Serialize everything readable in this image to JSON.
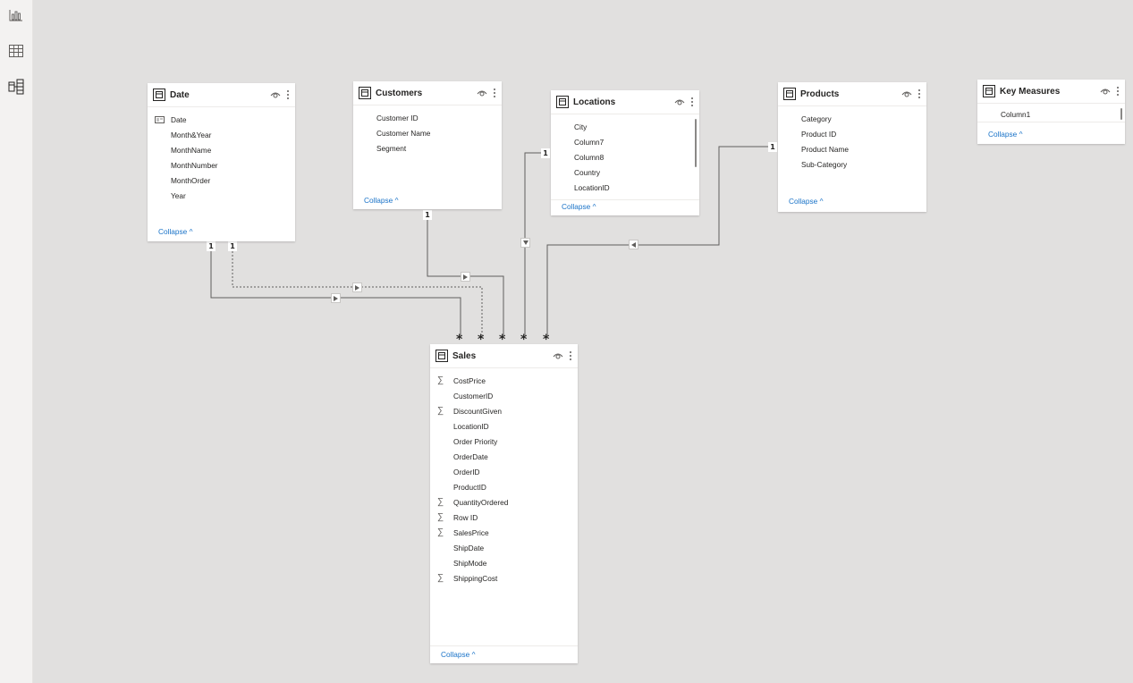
{
  "nav": {
    "report_icon": "bar-chart-icon",
    "data_icon": "table-grid-icon",
    "model_icon": "model-view-icon"
  },
  "colors": {
    "canvas": "#e1e0df",
    "accent_link": "#1a73c8",
    "line": "#605e5c"
  },
  "tables": {
    "date": {
      "name": "Date",
      "fields": [
        {
          "label": "Date",
          "icon": "calendar-icon"
        },
        {
          "label": "Month&Year",
          "icon": ""
        },
        {
          "label": "MonthName",
          "icon": ""
        },
        {
          "label": "MonthNumber",
          "icon": ""
        },
        {
          "label": "MonthOrder",
          "icon": ""
        },
        {
          "label": "Year",
          "icon": ""
        }
      ],
      "collapse": "Collapse ^"
    },
    "customers": {
      "name": "Customers",
      "fields": [
        {
          "label": "Customer ID",
          "icon": ""
        },
        {
          "label": "Customer Name",
          "icon": ""
        },
        {
          "label": "Segment",
          "icon": ""
        }
      ],
      "collapse": "Collapse ^"
    },
    "locations": {
      "name": "Locations",
      "fields": [
        {
          "label": "City",
          "icon": ""
        },
        {
          "label": "Column7",
          "icon": ""
        },
        {
          "label": "Column8",
          "icon": ""
        },
        {
          "label": "Country",
          "icon": ""
        },
        {
          "label": "LocationID",
          "icon": ""
        }
      ],
      "collapse": "Collapse ^"
    },
    "products": {
      "name": "Products",
      "fields": [
        {
          "label": "Category",
          "icon": ""
        },
        {
          "label": "Product ID",
          "icon": ""
        },
        {
          "label": "Product Name",
          "icon": ""
        },
        {
          "label": "Sub-Category",
          "icon": ""
        }
      ],
      "collapse": "Collapse ^"
    },
    "key_measures": {
      "name": "Key Measures",
      "fields": [
        {
          "label": "Column1",
          "icon": ""
        }
      ],
      "collapse": "Collapse ^"
    },
    "sales": {
      "name": "Sales",
      "fields": [
        {
          "label": "CostPrice",
          "icon": "sigma-icon"
        },
        {
          "label": "CustomerID",
          "icon": ""
        },
        {
          "label": "DiscountGiven",
          "icon": "sigma-icon"
        },
        {
          "label": "LocationID",
          "icon": ""
        },
        {
          "label": "Order Priority",
          "icon": ""
        },
        {
          "label": "OrderDate",
          "icon": ""
        },
        {
          "label": "OrderID",
          "icon": ""
        },
        {
          "label": "ProductID",
          "icon": ""
        },
        {
          "label": "QuantityOrdered",
          "icon": "sigma-icon"
        },
        {
          "label": "Row ID",
          "icon": "sigma-icon"
        },
        {
          "label": "SalesPrice",
          "icon": "sigma-icon"
        },
        {
          "label": "ShipDate",
          "icon": ""
        },
        {
          "label": "ShipMode",
          "icon": ""
        },
        {
          "label": "ShippingCost",
          "icon": "sigma-icon"
        }
      ],
      "collapse": "Collapse ^"
    }
  },
  "relationships": {
    "one_label": "1",
    "many_label": "*"
  }
}
